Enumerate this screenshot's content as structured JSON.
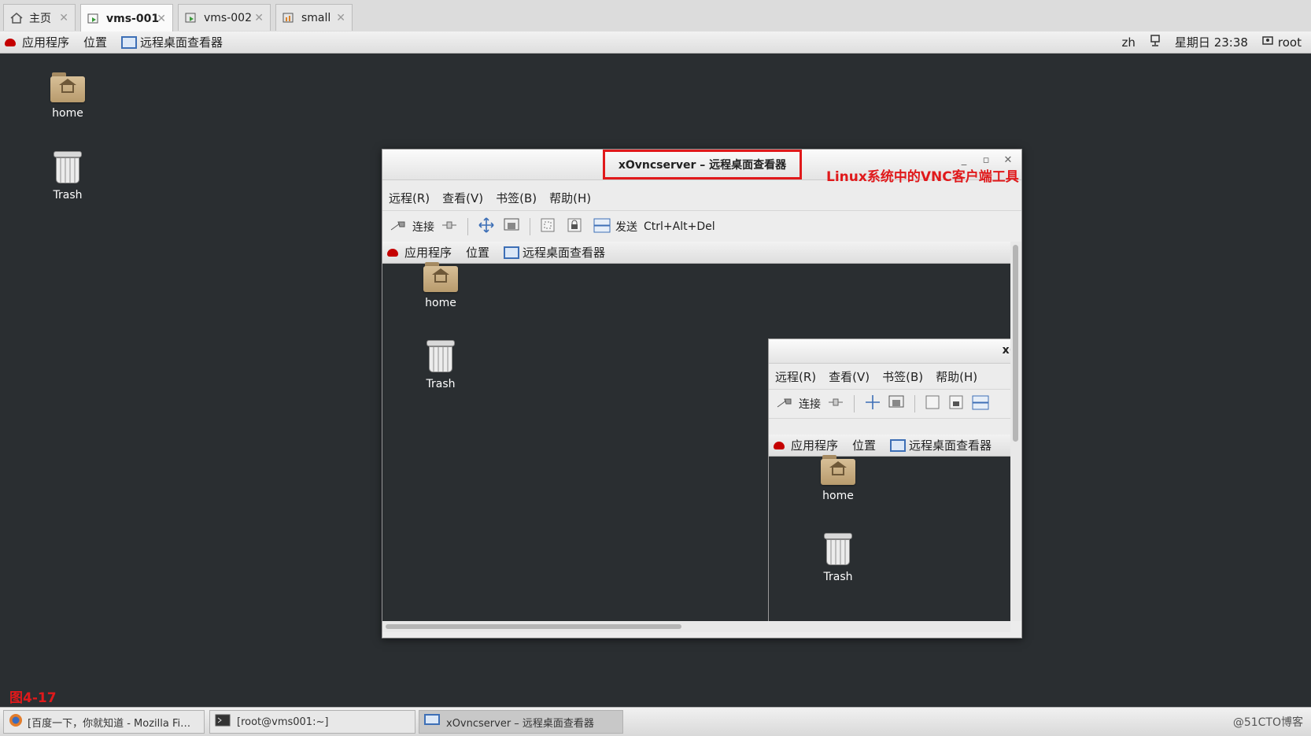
{
  "vmware_tabs": [
    {
      "label": "主页"
    },
    {
      "label": "vms-001"
    },
    {
      "label": "vms-002"
    },
    {
      "label": "small"
    }
  ],
  "top_panel": {
    "applications": "应用程序",
    "places": "位置",
    "viewer": "远程桌面查看器",
    "lang": "zh",
    "clock": "星期日 23:38",
    "user": "root"
  },
  "desktop_icons": [
    {
      "label": "home"
    },
    {
      "label": "Trash"
    }
  ],
  "vnc_window": {
    "title": "xOvncserver – 远程桌面查看器",
    "annotation": "Linux系统中的VNC客户端工具",
    "menu": [
      "远程(R)",
      "查看(V)",
      "书签(B)",
      "帮助(H)"
    ],
    "toolbar": {
      "connect": "连接",
      "send": "发送",
      "shortcut": "Ctrl+Alt+Del"
    },
    "inner_panel": {
      "applications": "应用程序",
      "places": "位置",
      "viewer": "远程桌面查看器"
    },
    "inner_icons": [
      {
        "label": "home"
      },
      {
        "label": "Trash"
      }
    ]
  },
  "nested_window": {
    "title_fragment": "x(",
    "menu": [
      "远程(R)",
      "查看(V)",
      "书签(B)",
      "帮助(H)"
    ],
    "connect": "连接",
    "inner_panel": {
      "applications": "应用程序",
      "places": "位置",
      "viewer": "远程桌面查看器"
    },
    "inner_icons": [
      {
        "label": "home"
      },
      {
        "label": "Trash"
      }
    ]
  },
  "figure_label": "图4-17",
  "taskbar": [
    {
      "label": "[百度一下，你就知道 - Mozilla Fi…"
    },
    {
      "label": "[root@vms001:~]"
    },
    {
      "label": "xOvncserver – 远程桌面查看器"
    }
  ],
  "watermark": "@51CTO博客",
  "colors": {
    "annotation_red": "#e0191b",
    "desktop_bg": "#2a2e31",
    "accent_blue": "#3d6fb6"
  }
}
